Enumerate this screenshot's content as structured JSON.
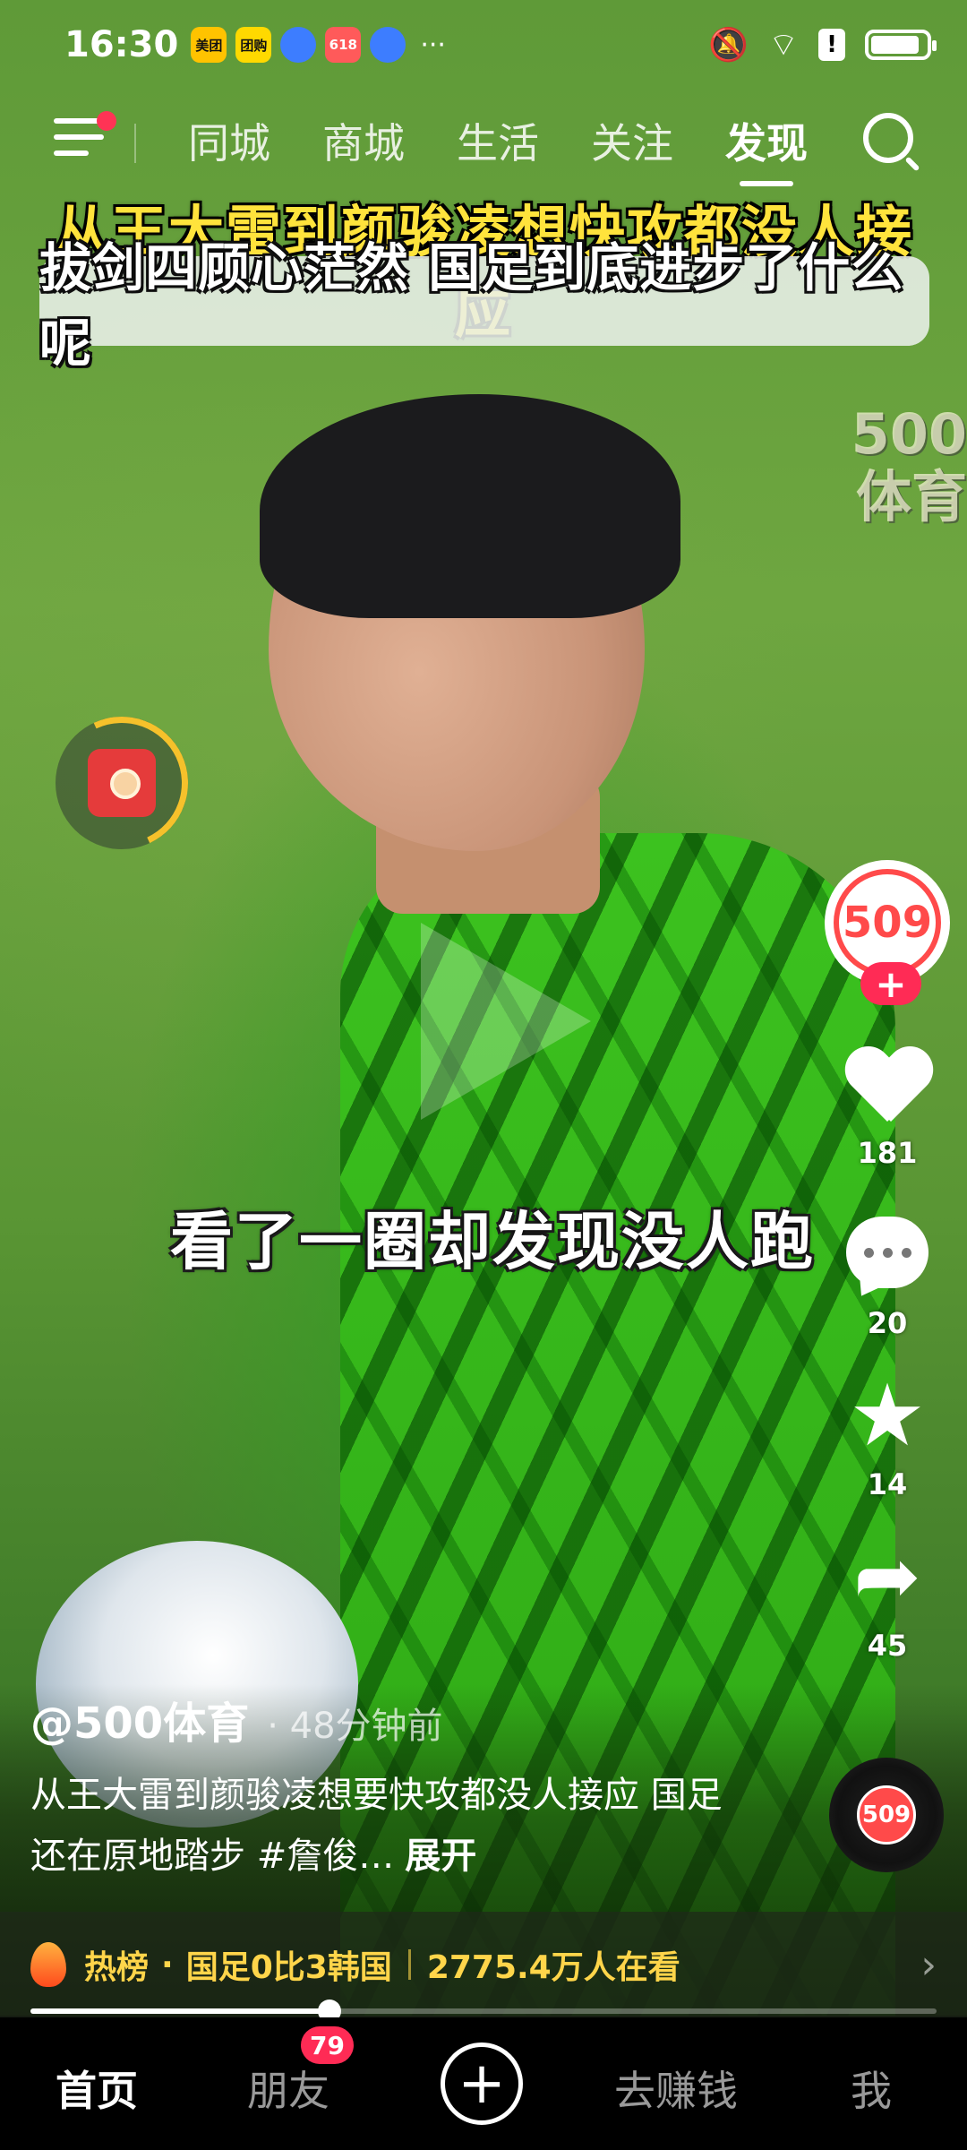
{
  "status_bar": {
    "time": "16:30",
    "notification_icons": [
      {
        "name": "meituan-icon",
        "label": "美团",
        "color": "#ffc300"
      },
      {
        "name": "tuangou-icon",
        "label": "团购",
        "color": "#ffd900"
      },
      {
        "name": "browser-icon",
        "label": "",
        "color": "#3d7dff"
      },
      {
        "name": "app-618-icon",
        "label": "618",
        "color": "#ff5a5a"
      },
      {
        "name": "browser-icon-2",
        "label": "",
        "color": "#3d7dff"
      }
    ],
    "more": "···",
    "right_icons": [
      "mute-icon",
      "wifi-icon",
      "alert-icon",
      "battery-icon"
    ]
  },
  "top_nav": {
    "tabs": [
      {
        "label": "同城",
        "active": false
      },
      {
        "label": "商城",
        "active": false
      },
      {
        "label": "生活",
        "active": false
      },
      {
        "label": "关注",
        "active": false
      },
      {
        "label": "发现",
        "active": true
      }
    ]
  },
  "video": {
    "caption_line_1": "从王大雷到颜骏凌想快攻都没人接应",
    "caption_line_2": "拔剑四顾心茫然 国足到底进步了什么呢",
    "watermark_line_1": "500",
    "watermark_line_2": "体育",
    "subtitle": "看了一圈却发现没人跑"
  },
  "rail": {
    "avatar_text": "509",
    "follow_label": "+",
    "likes": "181",
    "comments": "20",
    "favorites": "14",
    "shares": "45"
  },
  "post": {
    "author": "@500体育",
    "time": "· 48分钟前",
    "description": "从王大雷到颜骏凌想要快攻都没人接应 国足还在原地踏步 #詹俊…",
    "expand_label": "展开",
    "music_disc_text": "509"
  },
  "hot_list": {
    "label": "热榜",
    "separator": "·",
    "topic": "国足0比3韩国",
    "viewers": "2775.4万人在看",
    "arrow": "›"
  },
  "progress": {
    "fraction": 0.33
  },
  "tab_bar": {
    "home": "首页",
    "friends": "朋友",
    "friends_badge": "79",
    "add": "+",
    "earn": "去赚钱",
    "me": "我"
  },
  "colors": {
    "accent_red": "#ff2b55",
    "caption_yellow": "#ffe33c",
    "hot_yellow": "#ffd54a"
  }
}
